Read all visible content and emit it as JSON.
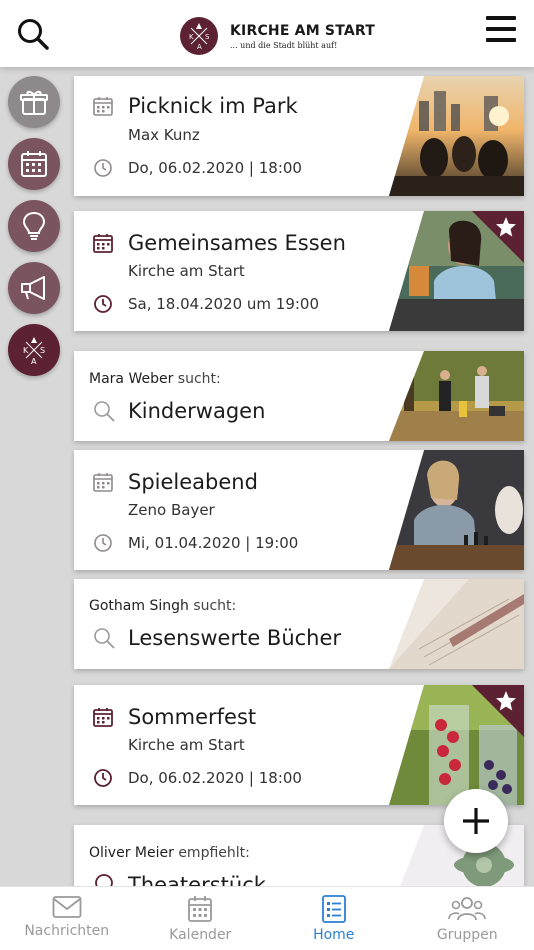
{
  "header": {
    "logo_title": "KIRCHE AM START",
    "logo_subtitle": "... und die Stadt blüht auf!",
    "logo_letters": [
      "K",
      "S",
      "A"
    ]
  },
  "side_rail": [
    {
      "name": "gift-icon",
      "style": "grey"
    },
    {
      "name": "calendar-icon",
      "style": "plum"
    },
    {
      "name": "lightbulb-icon",
      "style": "plum"
    },
    {
      "name": "megaphone-icon",
      "style": "plum"
    },
    {
      "name": "kas-logo-icon",
      "style": "dark"
    }
  ],
  "cards": [
    {
      "type": "event",
      "title": "Picknick im Park",
      "host": "Max Kunz",
      "time": "Do, 06.02.2020 | 18:00",
      "featured": false
    },
    {
      "type": "event",
      "title": "Gemeinsames Essen",
      "host": "Kirche am Start",
      "time": "Sa, 18.04.2020 um 19:00",
      "featured": true
    },
    {
      "type": "search",
      "person": "Mara Weber",
      "verb": "sucht:",
      "title": "Kinderwagen"
    },
    {
      "type": "event",
      "title": "Spieleabend",
      "host": "Zeno Bayer",
      "time": "Mi, 01.04.2020 | 19:00",
      "featured": false
    },
    {
      "type": "search",
      "person": "Gotham Singh",
      "verb": "sucht:",
      "title": "Lesenswerte Bücher"
    },
    {
      "type": "event",
      "title": "Sommerfest",
      "host": "Kirche am Start",
      "time": "Do, 06.02.2020 | 18:00",
      "featured": true
    },
    {
      "type": "recommend",
      "person": "Oliver Meier",
      "verb": "empfiehlt:",
      "title": "Theaterstück"
    }
  ],
  "tabs": [
    {
      "label": "Nachrichten",
      "icon": "mail-icon",
      "active": false
    },
    {
      "label": "Kalender",
      "icon": "calendar-icon",
      "active": false
    },
    {
      "label": "Home",
      "icon": "list-icon",
      "active": true
    },
    {
      "label": "Gruppen",
      "icon": "group-icon",
      "active": false
    }
  ],
  "colors": {
    "brand": "#5c2233",
    "accent": "#2b7fd6",
    "icon_grey": "#8e8a8c"
  }
}
